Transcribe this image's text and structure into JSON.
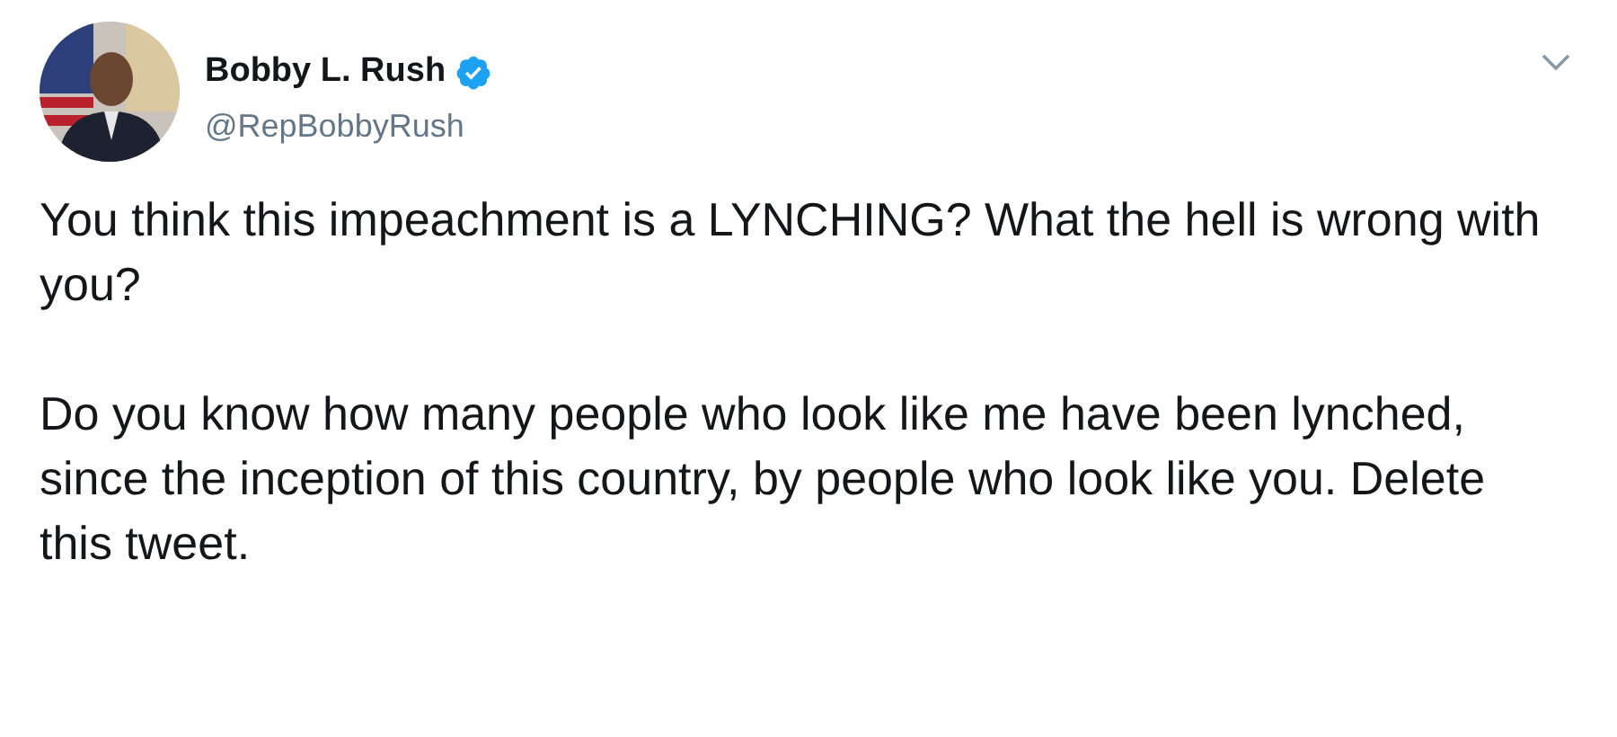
{
  "author": {
    "name": "Bobby L. Rush",
    "verified": true,
    "handle": "@RepBobbyRush"
  },
  "paragraphs": [
    "You think this impeachment is a LYNCHING? What the hell is wrong with you?",
    "Do you know how many people who look like me have been lynched, since the inception of this country, by people who look like you. Delete this tweet."
  ]
}
